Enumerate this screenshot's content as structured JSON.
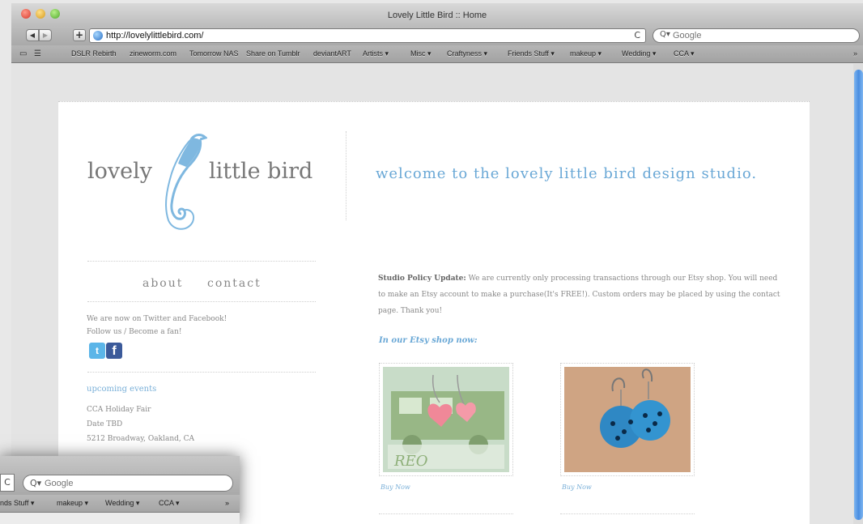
{
  "window": {
    "title": "Lovely Little Bird :: Home"
  },
  "toolbar": {
    "back_icon": "◀",
    "forward_icon": "▶",
    "add_bookmark_icon": "+",
    "url": "http://lovelylittlebird.com/",
    "reload_icon": "C",
    "search_placeholder": "Google",
    "search_icon": "Q▾"
  },
  "bookmarks": {
    "reading_list_icon": "▭",
    "bookmarks_icon": "☰",
    "items": [
      "DSLR Rebirth",
      "zineworm.com",
      "Tomorrow NAS",
      "Share on Tumblr",
      "deviantART",
      "Artists ▾",
      "Misc ▾",
      "Craftyness ▾",
      "Friends Stuff ▾",
      "makeup ▾",
      "Wedding ▾",
      "CCA ▾",
      "»"
    ]
  },
  "site": {
    "logo_left": "lovely",
    "logo_right": "little bird",
    "welcome": "welcome to the lovely little bird design studio.",
    "nav": {
      "about": "about",
      "contact": "contact"
    },
    "social_text_1": "We are now on Twitter and Facebook!",
    "social_text_2": "Follow us / Become a fan!",
    "twitter_glyph": "t",
    "facebook_glyph": "f",
    "events_heading": "upcoming events",
    "event_lines": [
      "CCA Holiday Fair",
      "Date TBD",
      "5212 Broadway, Oakland, CA"
    ],
    "policy_label": "Studio Policy Update:",
    "policy_text": " We are currently only processing transactions through our Etsy shop. You will need to make an Etsy account to make a purchase(It's FREE!). Custom orders may be placed by using the contact page. Thank you!",
    "etsy_heading": "In our Etsy shop now:",
    "products": [
      {
        "link": "Buy Now",
        "stamp": "REO"
      },
      {
        "link": "Buy Now"
      }
    ]
  },
  "inset": {
    "reload_icon": "C",
    "search_icon": "Q▾",
    "search_placeholder": "Google",
    "bookmarks": [
      "nds Stuff ▾",
      "makeup ▾",
      "Wedding ▾",
      "CCA ▾",
      "»"
    ]
  }
}
